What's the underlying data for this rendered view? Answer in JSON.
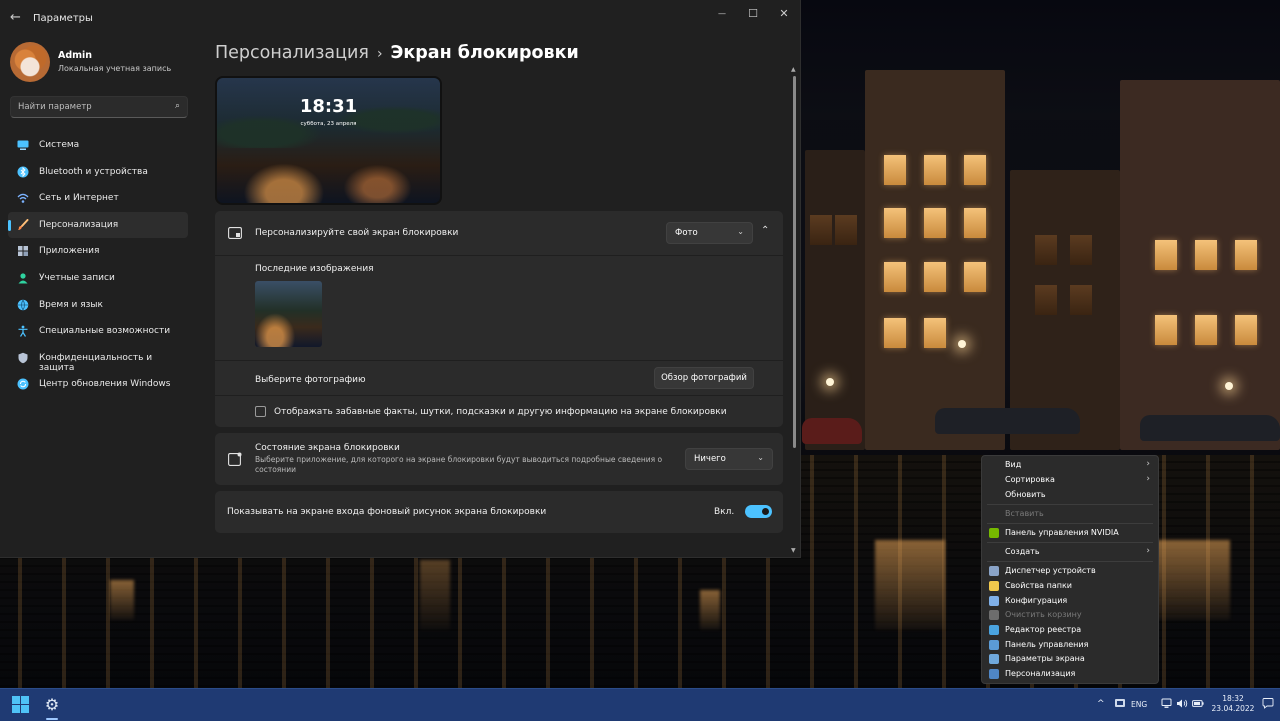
{
  "window": {
    "title": "Параметры",
    "back": "←",
    "minimize": "—",
    "maximize": "☐",
    "close": "✕"
  },
  "user": {
    "name": "Admin",
    "account_type": "Локальная учетная запись"
  },
  "search": {
    "placeholder": "Найти параметр",
    "icon": "search-icon"
  },
  "sidebar": {
    "items": [
      {
        "label": "Система",
        "icon": "monitor-icon",
        "color": "#4cc2ff",
        "active": false
      },
      {
        "label": "Bluetooth и устройства",
        "icon": "bluetooth-icon",
        "color": "#4cc2ff",
        "active": false
      },
      {
        "label": "Сеть и Интернет",
        "icon": "network-icon",
        "color": "#7cb3ff",
        "active": false
      },
      {
        "label": "Персонализация",
        "icon": "brush-icon",
        "color": "#ff9b5a",
        "active": true
      },
      {
        "label": "Приложения",
        "icon": "apps-icon",
        "color": "#b8c4d6",
        "active": false
      },
      {
        "label": "Учетные записи",
        "icon": "account-icon",
        "color": "#2fd3a0",
        "active": false
      },
      {
        "label": "Время и язык",
        "icon": "globe-icon",
        "color": "#4cc2ff",
        "active": false
      },
      {
        "label": "Специальные возможности",
        "icon": "accessibility-icon",
        "color": "#4cc2ff",
        "active": false
      },
      {
        "label": "Конфиденциальность и защита",
        "icon": "shield-icon",
        "color": "#b8c4d6",
        "active": false
      },
      {
        "label": "Центр обновления Windows",
        "icon": "update-icon",
        "color": "#4cc2ff",
        "active": false
      }
    ]
  },
  "breadcrumb": {
    "parent": "Персонализация",
    "separator": "›",
    "current": "Экран блокировки"
  },
  "preview": {
    "time": "18:31",
    "date": "суббота, 23 апреля"
  },
  "personalize_card": {
    "title": "Персонализируйте свой экран блокировки",
    "dropdown_value": "Фото",
    "recent_images_label": "Последние изображения",
    "choose_photo_label": "Выберите фотографию",
    "browse_button": "Обзор фотографий",
    "fun_facts_label": "Отображать забавные факты, шутки, подсказки и другую информацию на экране блокировки",
    "fun_facts_checked": false
  },
  "status_card": {
    "title": "Состояние экрана блокировки",
    "subtitle_line1": "Выберите приложение, для которого на экране блокировки будут выводиться подробные сведения о",
    "subtitle_line2": "состоянии",
    "dropdown_value": "Ничего"
  },
  "background_card": {
    "title": "Показывать на экране входа фоновый рисунок экрана блокировки",
    "toggle_label": "Вкл.",
    "toggle_on": true
  },
  "context_menu": {
    "items": [
      {
        "label": "Вид",
        "submenu": true
      },
      {
        "label": "Сортировка",
        "submenu": true
      },
      {
        "label": "Обновить",
        "submenu": false
      },
      {
        "label": "Вставить",
        "disabled": true
      },
      {
        "label": "Панель управления NVIDIA",
        "icon_color": "#76b900"
      },
      {
        "label": "Создать",
        "submenu": true
      },
      {
        "label": "Диспетчер устройств",
        "icon_color": "#8aa4c8"
      },
      {
        "label": "Свойства папки",
        "icon_color": "#f2c94c"
      },
      {
        "label": "Конфигурация",
        "icon_color": "#7fb0e8"
      },
      {
        "label": "Очистить корзину",
        "disabled": true,
        "icon_color": "#8a8a8a"
      },
      {
        "label": "Редактор реестра",
        "icon_color": "#4aa3df"
      },
      {
        "label": "Панель управления",
        "icon_color": "#5b9bd5"
      },
      {
        "label": "Параметры экрана",
        "icon_color": "#6fa8dc"
      },
      {
        "label": "Персонализация",
        "icon_color": "#4f86c6"
      }
    ]
  },
  "taskbar": {
    "language": "ENG",
    "time": "18:32",
    "date": "23.04.2022",
    "chevron": "^",
    "tray_icons": [
      "network-icon",
      "volume-icon",
      "battery-icon"
    ]
  }
}
